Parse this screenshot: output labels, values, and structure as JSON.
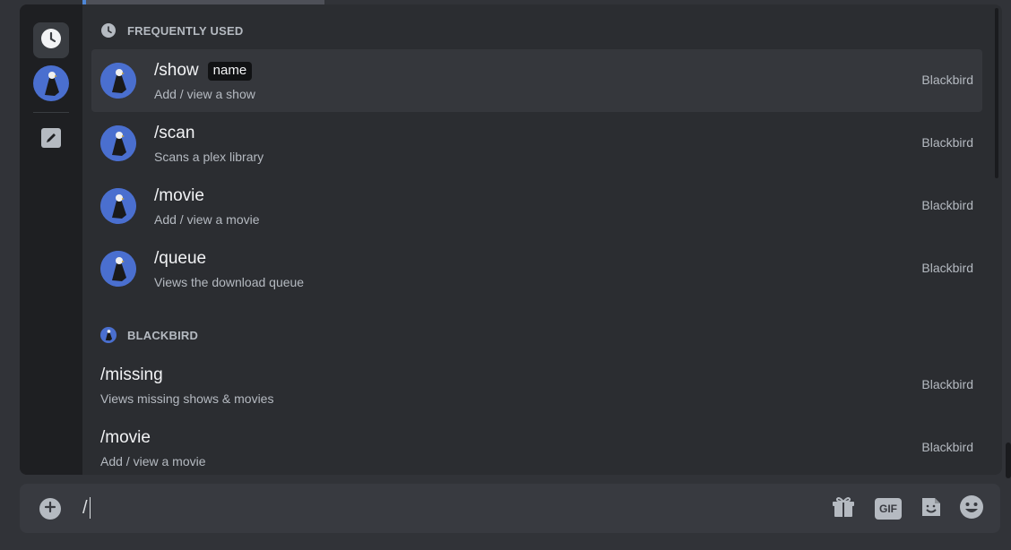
{
  "frequent_section": {
    "title": "FREQUENTLY USED"
  },
  "bot_section": {
    "title": "BLACKBIRD"
  },
  "frequent_commands": [
    {
      "name": "/show",
      "option": "name",
      "description": "Add / view a show",
      "source": "Blackbird"
    },
    {
      "name": "/scan",
      "description": "Scans a plex library",
      "source": "Blackbird"
    },
    {
      "name": "/movie",
      "description": "Add / view a movie",
      "source": "Blackbird"
    },
    {
      "name": "/queue",
      "description": "Views the download queue",
      "source": "Blackbird"
    }
  ],
  "bot_commands": [
    {
      "name": "/missing",
      "description": "Views missing shows & movies",
      "source": "Blackbird"
    },
    {
      "name": "/movie",
      "description": "Add / view a movie",
      "source": "Blackbird"
    }
  ],
  "composer": {
    "value": "/"
  },
  "icons": {
    "rail": [
      "clock-icon",
      "bot-avatar",
      "pencil-icon"
    ],
    "composer": [
      "plus-icon",
      "gift-icon",
      "gif-icon",
      "sticker-icon",
      "emoji-icon"
    ]
  },
  "colors": {
    "popup_bg": "#2b2d31",
    "rail_bg": "#1e1f22",
    "selected_row": "#35373c",
    "avatar_bg": "#4a6fcf",
    "composer_bg": "#383a40"
  }
}
